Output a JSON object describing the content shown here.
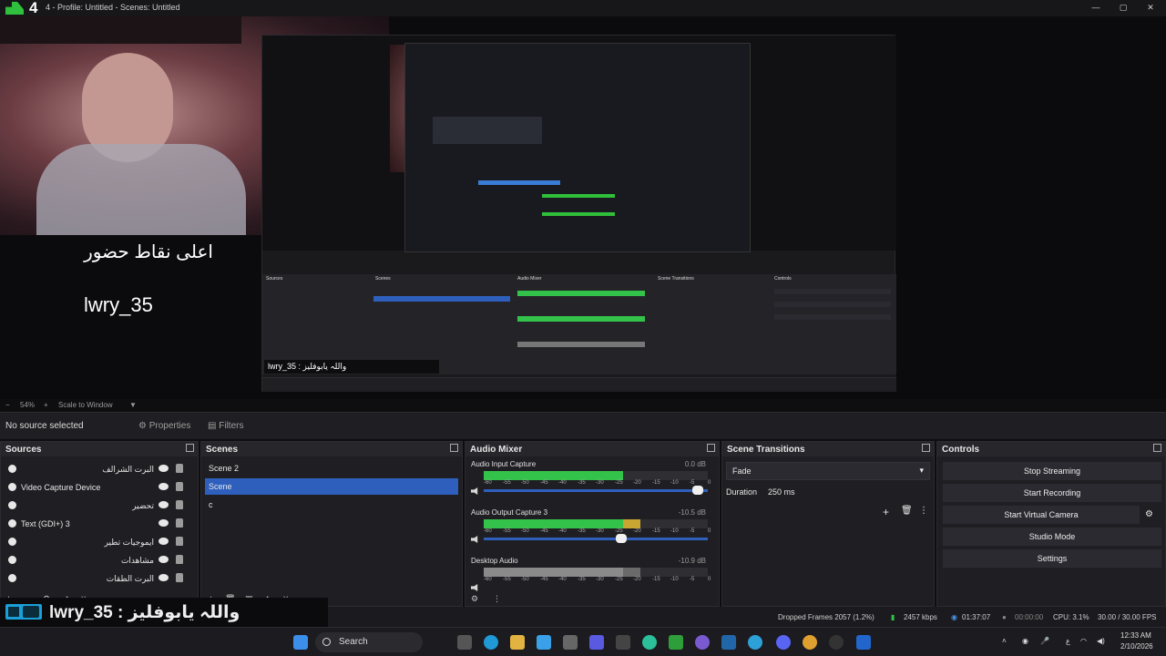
{
  "window": {
    "title": "4 - Profile: Untitled - Scenes: Untitled",
    "logo_number": "4"
  },
  "preview": {
    "overlay_arabic": "اعلى نقاط حضور",
    "overlay_username": "lwry_35",
    "nested_chat": "lwry_35 : واللہ یابوفلیز"
  },
  "zoom": {
    "level": "54%",
    "plus": "+",
    "minus": "−",
    "mode": "Scale to Window"
  },
  "context_bar": {
    "no_source": "No source selected",
    "properties": "Properties",
    "filters": "Filters"
  },
  "sources": {
    "title": "Sources",
    "items": [
      {
        "name": "البرت الشرالف",
        "rtl": true
      },
      {
        "name": "Video Capture Device",
        "rtl": false
      },
      {
        "name": "تحضير",
        "rtl": true
      },
      {
        "name": "Text (GDI+) 3",
        "rtl": false
      },
      {
        "name": "ايموجيات تطير",
        "rtl": true
      },
      {
        "name": "مشاهدات",
        "rtl": true
      },
      {
        "name": "البرت الطقات",
        "rtl": true
      }
    ],
    "toolbar": {
      "add": "+",
      "remove": "−",
      "settings": "⚙",
      "up": "˄",
      "down": "˅"
    }
  },
  "scenes": {
    "title": "Scenes",
    "items": [
      "Scene 2",
      "Scene",
      "c"
    ],
    "selected_index": 1,
    "toolbar": {
      "add": "+",
      "remove": "🗑",
      "filters": "▣",
      "up": "˄",
      "down": "˅"
    }
  },
  "audio_mixer": {
    "title": "Audio Mixer",
    "channels": [
      {
        "name": "Audio Input Capture",
        "db": "0.0 dB",
        "level": 0.62,
        "volume": 0.98,
        "color": "#33c24a"
      },
      {
        "name": "Audio Output Capture 3",
        "db": "-10.5 dB",
        "level": 0.7,
        "volume": 0.62,
        "color": "#33c24a"
      },
      {
        "name": "Desktop Audio",
        "db": "-10.9 dB",
        "level": 0.7,
        "volume": 0.66,
        "color": "#8a8a8a"
      }
    ],
    "ticks": [
      "-60",
      "-55",
      "-50",
      "-45",
      "-40",
      "-35",
      "-30",
      "-25",
      "-20",
      "-15",
      "-10",
      "-5",
      "0"
    ]
  },
  "scene_transitions": {
    "title": "Scene Transitions",
    "transition": "Fade",
    "duration_label": "Duration",
    "duration_value": "250 ms"
  },
  "controls": {
    "title": "Controls",
    "buttons": [
      "Stop Streaming",
      "Start Recording",
      "Start Virtual Camera",
      "Studio Mode",
      "Settings"
    ]
  },
  "status": {
    "dropped_frames": "Dropped Frames 2057 (1.2%)",
    "bitrate": "2457 kbps",
    "stream_time": "01:37:07",
    "rec_time": "00:00:00",
    "cpu": "CPU: 3.1%",
    "fps": "30.00 / 30.00 FPS"
  },
  "chat_overlay": {
    "text": "lwry_35 : واللہ یابوفلیز"
  },
  "taskbar": {
    "search": "Search",
    "time": "12:33 AM",
    "date": "2/10/2026"
  },
  "colors": {
    "accent": "#2f5fbd",
    "meter_green": "#33c24a",
    "meter_yellow": "#c9a531",
    "meter_red": "#c2313d"
  }
}
